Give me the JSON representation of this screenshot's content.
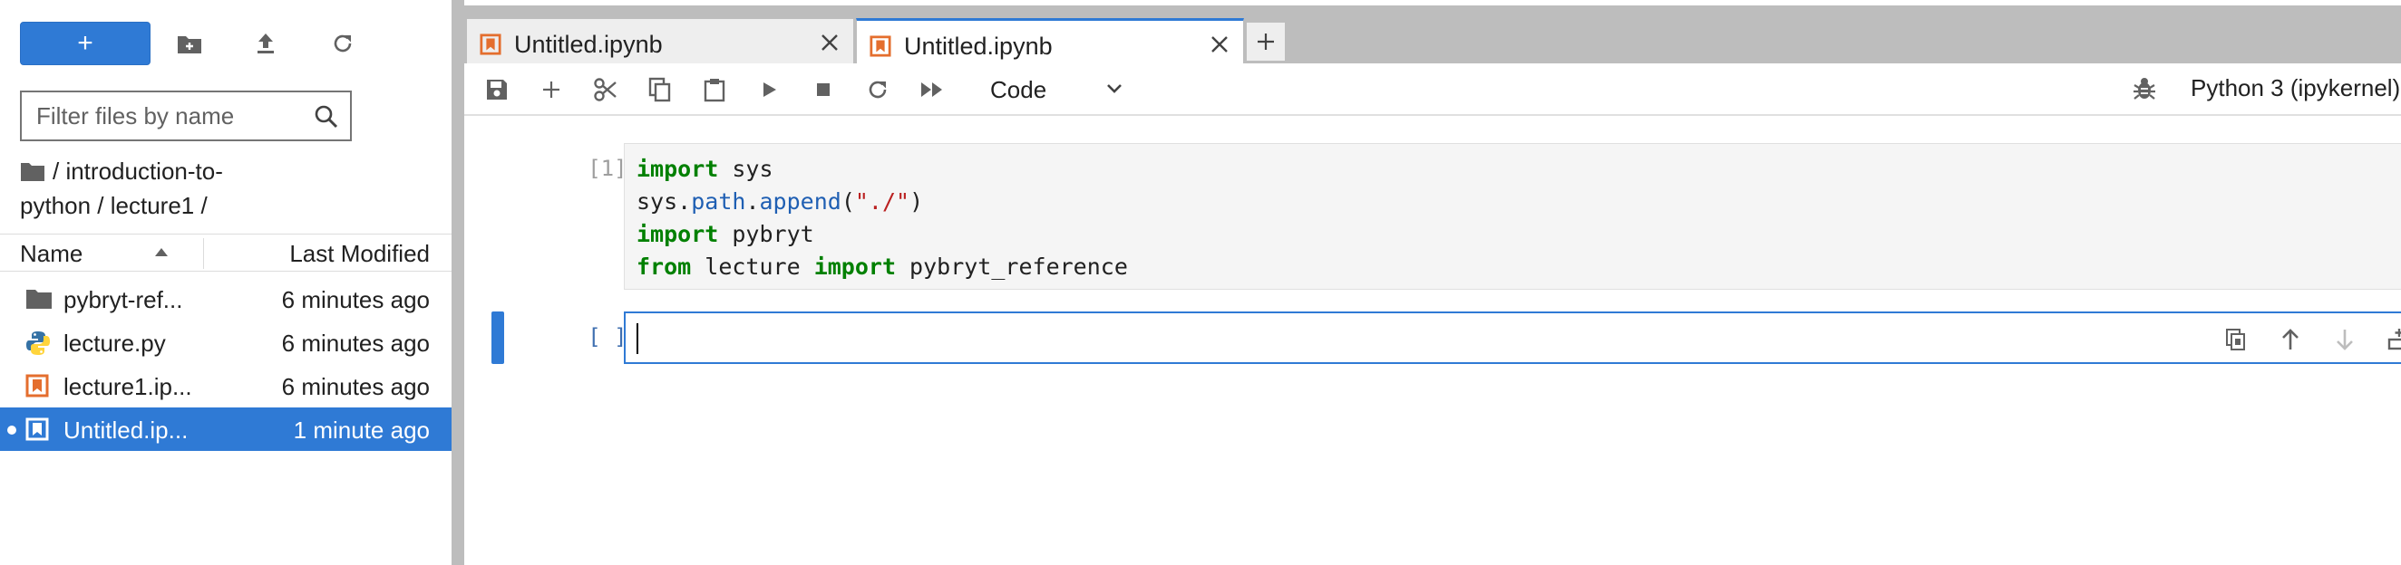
{
  "filebrowser": {
    "new_label": "+",
    "search_placeholder": "Filter files by name",
    "breadcrumb": "/ introduction-to-python / lecture1 /",
    "columns": {
      "name": "Name",
      "modified": "Last Modified"
    },
    "files": [
      {
        "name": "pybryt-ref...",
        "modified": "6 minutes ago",
        "icon": "folder-icon"
      },
      {
        "name": "lecture.py",
        "modified": "6 minutes ago",
        "icon": "python-file-icon"
      },
      {
        "name": "lecture1.ip...",
        "modified": "6 minutes ago",
        "icon": "notebook-icon"
      },
      {
        "name": "Untitled.ip...",
        "modified": "1 minute ago",
        "icon": "notebook-icon",
        "selected": true,
        "running": true
      }
    ]
  },
  "tabs": [
    {
      "label": "Untitled.ipynb",
      "active": false
    },
    {
      "label": "Untitled.ipynb",
      "active": true
    }
  ],
  "toolbar": {
    "cell_type": "Code",
    "kernel": "Python 3 (ipykernel)"
  },
  "cells": [
    {
      "prompt": "[1]:",
      "code": [
        "import sys",
        "sys.path.append(\"./\")",
        "import pybryt",
        "from lecture import pybryt_reference"
      ]
    },
    {
      "prompt": "[ ]:",
      "code": [
        ""
      ]
    }
  ],
  "colors": {
    "accent": "#2f7ad5",
    "notebook_orange": "#e46e2e",
    "keyword": "#008000",
    "string": "#ba2121"
  }
}
